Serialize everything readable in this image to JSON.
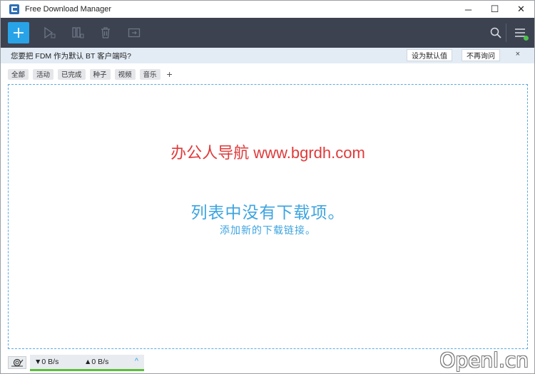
{
  "window": {
    "title": "Free Download Manager",
    "minimize": "─",
    "maximize": "☐",
    "close": "✕"
  },
  "toolbar": {
    "icons": [
      "plus-icon",
      "play-icon",
      "pause-icon",
      "trash-icon",
      "move-icon",
      "search-icon",
      "menu-icon"
    ],
    "accent": "#29a3e8",
    "background": "#3c4250",
    "status_dot": "#4cc24c"
  },
  "banner": {
    "text": "您要把 FDM 作为默认 BT 客户端吗?",
    "set_default": "设为默认值",
    "dont_ask": "不再询问",
    "close": "×"
  },
  "tabs": [
    "全部",
    "活动",
    "已完成",
    "种子",
    "视频",
    "音乐"
  ],
  "tab_add": "+",
  "main": {
    "watermark": "办公人导航 www.bgrdh.com",
    "empty_title": "列表中没有下载项。",
    "empty_subtitle": "添加新的下载链接。"
  },
  "status": {
    "down_speed": "▼0 B/s",
    "up_speed": "▲0 B/s",
    "expand": "^",
    "corner_watermark": "Openl.cn"
  }
}
